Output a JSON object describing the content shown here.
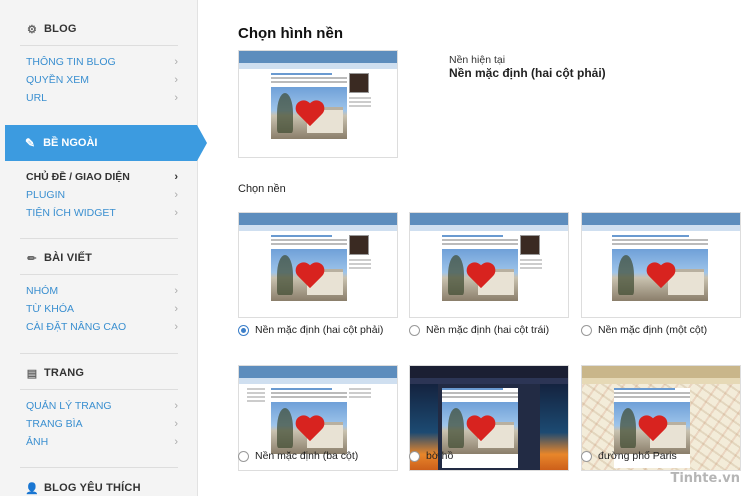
{
  "sidebar": {
    "blog": {
      "heading": "BLOG",
      "items": [
        "THÔNG TIN BLOG",
        "QUYỀN XEM",
        "URL"
      ]
    },
    "appearance": {
      "heading": "BỀ NGOÀI",
      "items": [
        "CHỦ ĐỀ / GIAO DIỆN",
        "PLUGIN",
        "TIỆN ÍCH WIDGET"
      ]
    },
    "posts": {
      "heading": "BÀI VIẾT",
      "items": [
        "NHÓM",
        "TỪ KHÓA",
        "CÀI ĐẶT NÂNG CAO"
      ]
    },
    "pages": {
      "heading": "TRANG",
      "items": [
        "QUẢN LÝ TRANG",
        "TRANG BÌA",
        "ẢNH"
      ]
    },
    "favorites": {
      "heading": "BLOG YÊU THÍCH"
    }
  },
  "main": {
    "title": "Chọn hình nền",
    "current_label": "Nền hiện tại",
    "current_value": "Nền mặc định (hai cột phải)",
    "choose_label": "Chọn nền",
    "themes": [
      {
        "label": "Nền mặc định (hai cột phải)",
        "selected": true
      },
      {
        "label": "Nền mặc định (hai cột trái)",
        "selected": false
      },
      {
        "label": "Nền mặc định (một cột)",
        "selected": false
      },
      {
        "label": "Nền mặc định (ba cột)",
        "selected": false
      },
      {
        "label": "bờ hồ",
        "selected": false
      },
      {
        "label": "đường phố Paris",
        "selected": false
      }
    ]
  },
  "watermark": "Tinhte.vn"
}
